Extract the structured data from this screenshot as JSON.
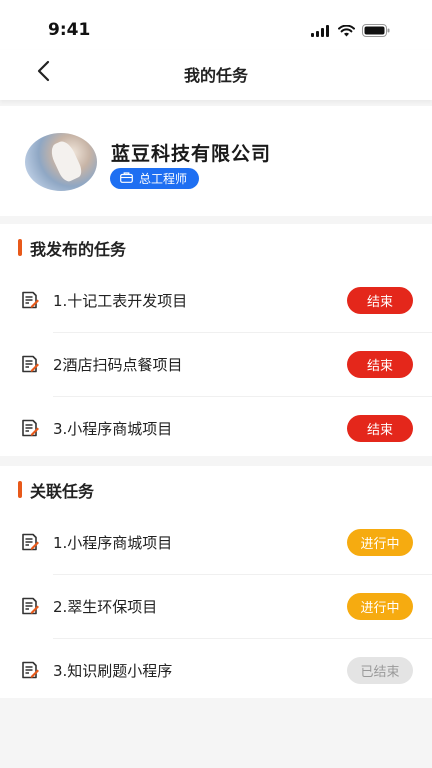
{
  "status_bar": {
    "time": "9:41"
  },
  "nav": {
    "title": "我的任务"
  },
  "profile": {
    "company": "蓝豆科技有限公司",
    "role": "总工程师"
  },
  "my_tasks": {
    "title": "我发布的任务",
    "items": [
      {
        "name": "1.十记工表开发项目",
        "status": "结束"
      },
      {
        "name": "2酒店扫码点餐项目",
        "status": "结束"
      },
      {
        "name": "3.小程序商城项目",
        "status": "结束"
      }
    ]
  },
  "related_tasks": {
    "title": "关联任务",
    "items": [
      {
        "name": "1.小程序商城项目",
        "status": "进行中"
      },
      {
        "name": "2.翠生环保项目",
        "status": "进行中"
      },
      {
        "name": "3.知识刷题小程序",
        "status": "已结束"
      }
    ]
  },
  "colors": {
    "accent_bar": "#e8591a",
    "status_ended": "#e4271b",
    "status_in_progress": "#f6ab10",
    "status_finished": "#e4e4e4",
    "role_badge": "#1e6ff2"
  },
  "icons": {
    "back": "chevron-left-icon",
    "task": "document-edit-icon",
    "role": "briefcase-icon"
  }
}
